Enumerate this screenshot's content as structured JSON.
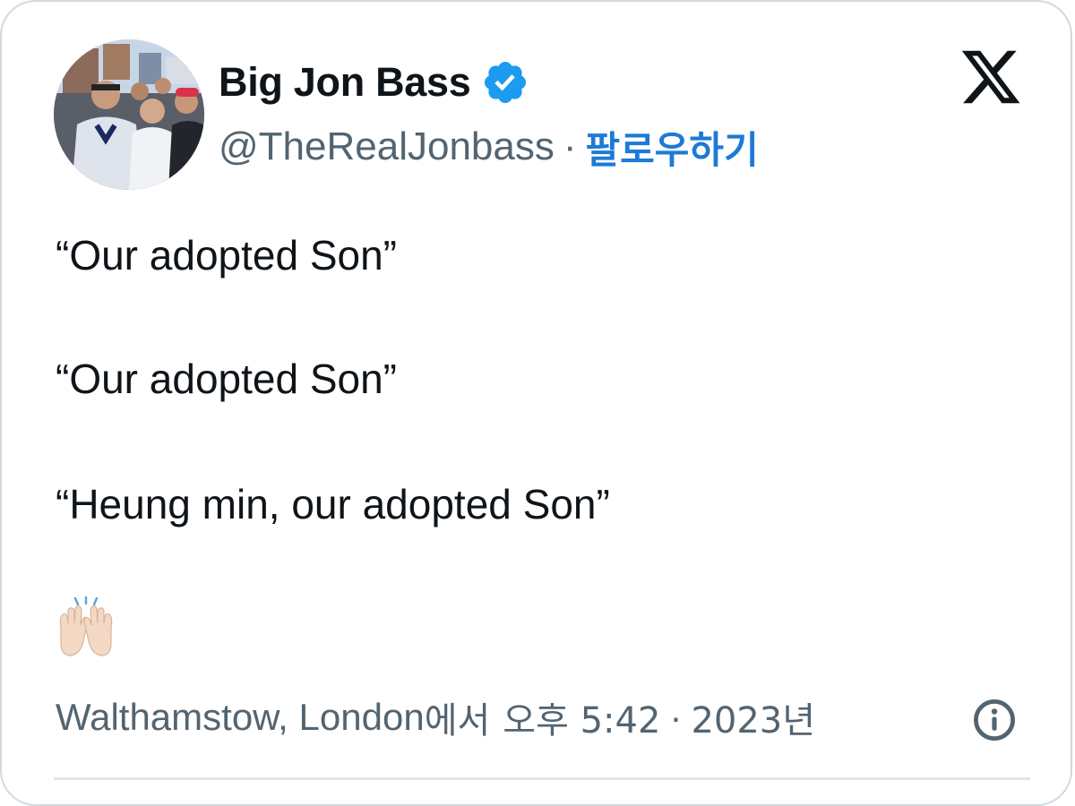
{
  "author": {
    "display_name": "Big Jon Bass",
    "handle": "@TheRealJonbass",
    "separator": "·",
    "follow_label": "팔로우하기",
    "verified": true
  },
  "tweet": {
    "lines": [
      "“Our adopted Son”",
      "“Our adopted Son”",
      "“Heung min, our adopted Son”"
    ],
    "emoji": "🙌🏻"
  },
  "meta": {
    "location": "Walthamstow, London",
    "location_suffix": "에서",
    "time": "오후 5:42",
    "separator": "·",
    "year": "2023년"
  },
  "icons": {
    "brand": "x-logo-icon",
    "verified": "verified-badge-icon",
    "info": "info-icon"
  },
  "colors": {
    "verified_blue": "#1d9bf0",
    "link_blue": "#1d7ad6",
    "text_primary": "#0f1419",
    "text_secondary": "#536471"
  }
}
